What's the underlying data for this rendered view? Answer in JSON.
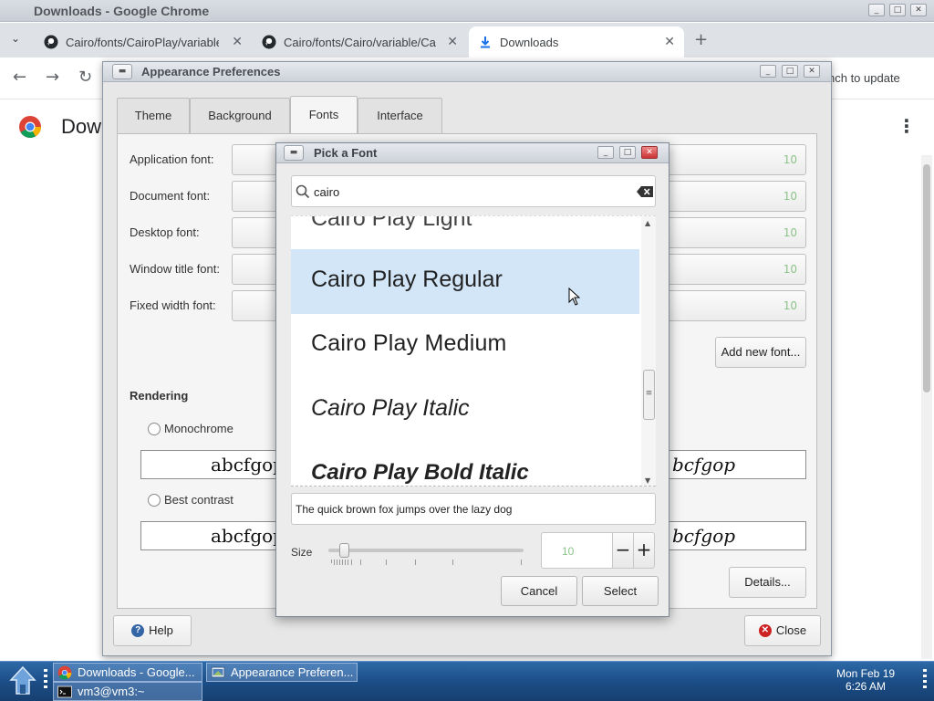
{
  "chrome": {
    "title": "Downloads - Google Chrome",
    "tabs": [
      {
        "label": "Cairo/fonts/CairoPlay/variable",
        "icon": "github-icon"
      },
      {
        "label": "Cairo/fonts/Cairo/variable/Ca",
        "icon": "github-icon"
      },
      {
        "label": "Downloads",
        "icon": "download-icon"
      }
    ],
    "update_text": "nch to update",
    "page_heading": "Dow"
  },
  "appearance": {
    "title": "Appearance Preferences",
    "tabs": [
      "Theme",
      "Background",
      "Fonts",
      "Interface"
    ],
    "active_tab": "Fonts",
    "fonts": [
      {
        "label": "Application font:",
        "size": "10"
      },
      {
        "label": "Document font:",
        "size": "10"
      },
      {
        "label": "Desktop font:",
        "size": "10"
      },
      {
        "label": "Window title font:",
        "size": "10"
      },
      {
        "label": "Fixed width font:",
        "size": "10"
      }
    ],
    "add_font_label": "Add new font...",
    "rendering_label": "Rendering",
    "rendering_options": [
      {
        "label": "Monochrome",
        "preview": "abcfgop",
        "preview_right": "bcfgop"
      },
      {
        "label": "Best contrast",
        "preview": "abcfgop",
        "preview_right": "bcfgop"
      }
    ],
    "details_label": "Details...",
    "help_label": "Help",
    "close_label": "Close"
  },
  "font_dialog": {
    "title": "Pick a Font",
    "search_value": "cairo",
    "fonts": [
      {
        "name": "Cairo Play Light",
        "style": "light"
      },
      {
        "name": "Cairo Play Regular",
        "style": "regular",
        "selected": true
      },
      {
        "name": "Cairo Play Medium",
        "style": "medium"
      },
      {
        "name": "Cairo Play Italic",
        "style": "italic"
      },
      {
        "name": "Cairo Play Bold Italic",
        "style": "bold-italic"
      }
    ],
    "preview_text": "The quick brown fox jumps over the lazy dog",
    "size_label": "Size",
    "size_value": "10",
    "size_slider_fraction": 0.06,
    "cancel_label": "Cancel",
    "select_label": "Select"
  },
  "taskbar": {
    "items": [
      {
        "label": "Downloads - Google...",
        "icon": "chrome-icon"
      },
      {
        "label": "Appearance Preferen...",
        "icon": "preferences-icon"
      },
      {
        "label": "vm3@vm3:~",
        "icon": "terminal-icon"
      }
    ],
    "clock_date": "Mon Feb 19",
    "clock_time": "6:26 AM"
  },
  "colors": {
    "selection": "#d2e6f8",
    "taskbar": "#1c4e87",
    "size_text": "#8bc38b"
  }
}
